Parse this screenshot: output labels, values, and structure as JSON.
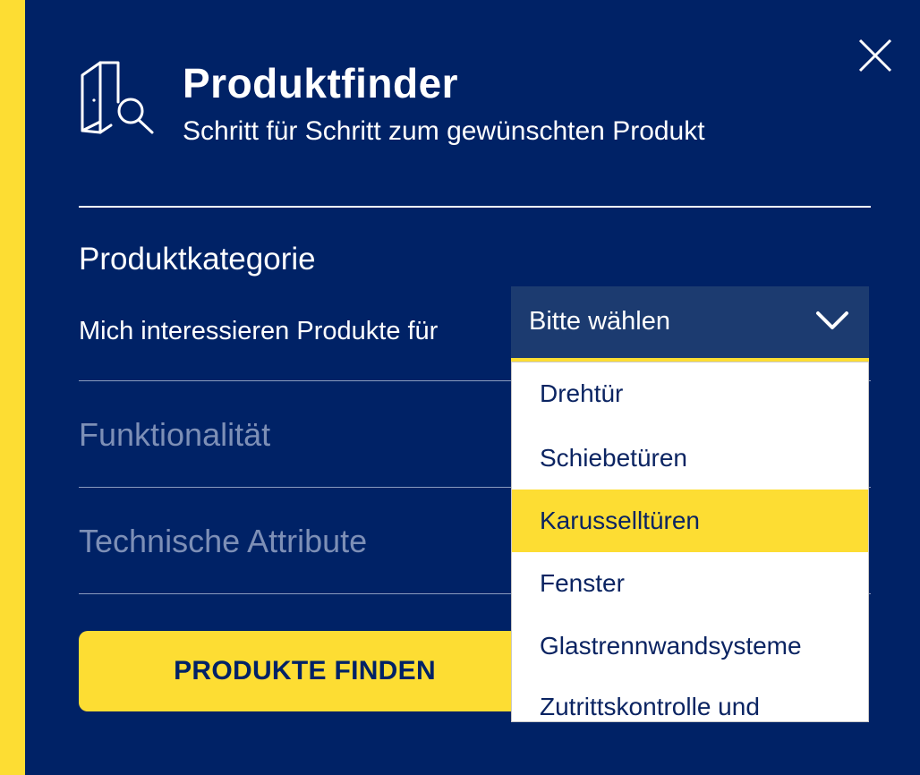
{
  "header": {
    "title": "Produktfinder",
    "subtitle": "Schritt für Schritt zum gewünschten Produkt",
    "icon": "door-search-icon",
    "close_icon": "close-icon"
  },
  "category": {
    "title": "Produktkategorie",
    "label": "Mich interessieren Produkte für",
    "select": {
      "value": "Bitte wählen",
      "icon": "chevron-down-icon",
      "highlighted_index": 2,
      "options": [
        "Drehtür",
        "Schiebetüren",
        "Karusselltüren",
        "Fenster",
        "Glastrennwandsysteme",
        "Zutrittskontrolle und"
      ]
    }
  },
  "sections": {
    "functionality": "Funktionalität",
    "technical": "Technische Attribute"
  },
  "actions": {
    "find_button": "PRODUKTE FINDEN"
  },
  "colors": {
    "panel_bg": "#002266",
    "accent": "#fddd33",
    "select_bg": "#1c3b70",
    "option_text": "#0b2462",
    "muted_text": "#7d8fb6"
  }
}
